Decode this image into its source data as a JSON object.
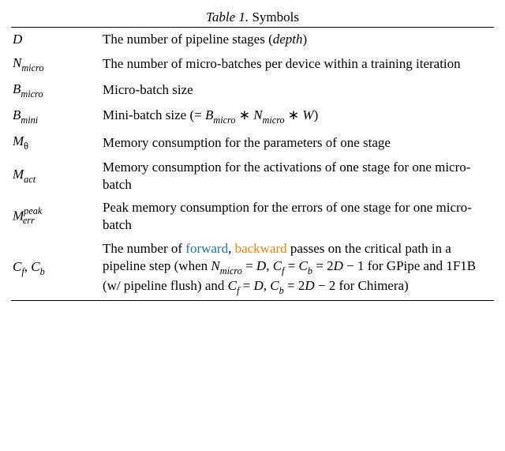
{
  "caption": {
    "label": "Table 1.",
    "title": "Symbols"
  },
  "rows": {
    "D": {
      "sym_main": "D",
      "desc_pre": "The number of pipeline stages (",
      "desc_emph": "depth",
      "desc_post": ")"
    },
    "Nmicro": {
      "sym_main": "N",
      "sym_sub": "micro",
      "desc": "The number of micro-batches per device within a training iteration"
    },
    "Bmicro": {
      "sym_main": "B",
      "sym_sub": "micro",
      "desc": "Micro-batch size"
    },
    "Bmini": {
      "sym_main": "B",
      "sym_sub": "mini",
      "desc_pre": "Mini-batch size (= ",
      "t1m": "B",
      "t1s": "micro",
      "times1": " ∗ ",
      "t2m": "N",
      "t2s": "micro",
      "times2": " ∗ ",
      "t3m": "W",
      "desc_post": ")"
    },
    "Mtheta": {
      "sym_main": "M",
      "sym_sub": "θ",
      "desc": "Memory consumption for the parameters of one stage"
    },
    "Mact": {
      "sym_main": "M",
      "sym_sub": "act",
      "desc": "Memory consumption for the activations of one stage for one micro-batch"
    },
    "Merr": {
      "sym_main": "M",
      "sym_sub": "err",
      "sym_sup": "peak",
      "desc": "Peak memory consumption for the errors of one stage for one micro-batch"
    },
    "CfCb": {
      "symA_main": "C",
      "symA_sub": "f",
      "comma": ", ",
      "symB_main": "C",
      "symB_sub": "b",
      "p_pre": "The number of ",
      "p_fwd": "forward",
      "p_mid1": ", ",
      "p_bwd": "backward",
      "p_mid2": " passes on the critical path in a pipeline step (when ",
      "e_Nm_main": "N",
      "e_Nm_sub": "micro",
      "p_eq1": " = ",
      "e_D1": "D",
      "p_c1": ", ",
      "e_Cf_main": "C",
      "e_Cf_sub": "f",
      "p_eq2": " = ",
      "e_Cb_main": "C",
      "e_Cb_sub": "b",
      "p_eq3": " = 2",
      "e_D2": "D",
      "p_m1": " − 1 for GPipe and 1F1B (w/ pipeline flush) and ",
      "e_Cf2_main": "C",
      "e_Cf2_sub": "f",
      "p_eq4": " = ",
      "e_D3": "D",
      "p_c2": ", ",
      "e_Cb2_main": "C",
      "e_Cb2_sub": "b",
      "p_eq5": " = 2",
      "e_D4": "D",
      "p_m2": " − 2 for Chimera)"
    }
  }
}
